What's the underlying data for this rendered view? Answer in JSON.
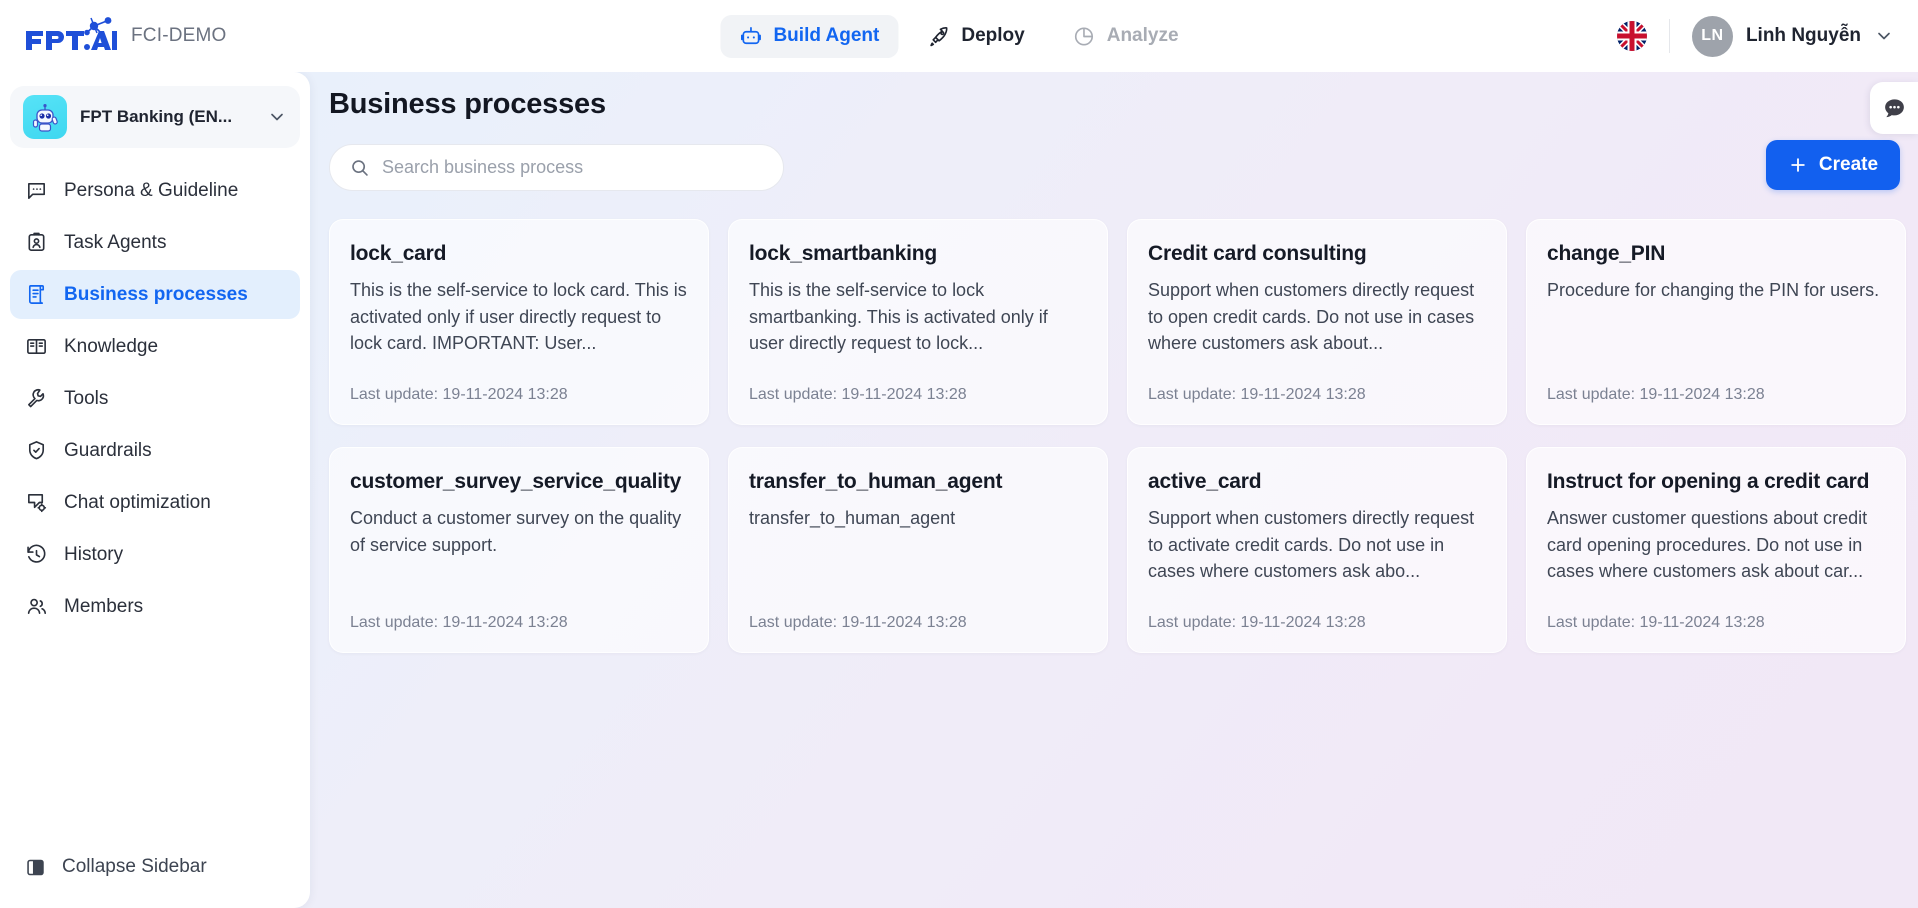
{
  "header": {
    "brand_name": "FPT.AI",
    "brand_sub": "FCI-DEMO",
    "tabs": [
      {
        "label": "Build Agent",
        "icon": "robot-icon",
        "state": "active"
      },
      {
        "label": "Deploy",
        "icon": "rocket-icon",
        "state": "default"
      },
      {
        "label": "Analyze",
        "icon": "pie-chart-icon",
        "state": "disabled"
      }
    ],
    "language_flag": "uk-flag-icon",
    "user": {
      "initials": "LN",
      "name": "Linh Nguyễn"
    }
  },
  "sidebar": {
    "agent": {
      "name": "FPT Banking (EN...",
      "avatar": "robot-avatar"
    },
    "items": [
      {
        "label": "Persona & Guideline",
        "icon": "chat-dots-icon",
        "active": false
      },
      {
        "label": "Task Agents",
        "icon": "id-badge-icon",
        "active": false
      },
      {
        "label": "Business processes",
        "icon": "scroll-document-icon",
        "active": true
      },
      {
        "label": "Knowledge",
        "icon": "open-book-icon",
        "active": false
      },
      {
        "label": "Tools",
        "icon": "wrench-icon",
        "active": false
      },
      {
        "label": "Guardrails",
        "icon": "shield-check-icon",
        "active": false
      },
      {
        "label": "Chat optimization",
        "icon": "chat-gear-icon",
        "active": false
      },
      {
        "label": "History",
        "icon": "clock-history-icon",
        "active": false
      },
      {
        "label": "Members",
        "icon": "users-icon",
        "active": false
      }
    ],
    "collapse_label": "Collapse Sidebar",
    "collapse_icon": "panel-collapse-icon"
  },
  "main": {
    "title": "Business processes",
    "search": {
      "placeholder": "Search business process",
      "value": "",
      "icon": "search-icon"
    },
    "create_button": {
      "label": "Create",
      "icon": "plus-icon"
    },
    "cards": [
      {
        "title": "lock_card",
        "description": "This is the self-service to lock card. This is activated only if user directly request to lock card. IMPORTANT: User...",
        "updated": "Last update: 19-11-2024 13:28"
      },
      {
        "title": "lock_smartbanking",
        "description": "This is the self-service to lock smartbanking. This is activated only if user directly request to lock...",
        "updated": "Last update: 19-11-2024 13:28"
      },
      {
        "title": "Credit card consulting",
        "description": "Support when customers directly request to open credit cards. Do not use in cases where customers ask about...",
        "updated": "Last update: 19-11-2024 13:28"
      },
      {
        "title": "change_PIN",
        "description": "Procedure for changing the PIN for users.",
        "updated": "Last update: 19-11-2024 13:28"
      },
      {
        "title": "customer_survey_service_quality",
        "description": "Conduct a customer survey on the quality of service support.",
        "updated": "Last update: 19-11-2024 13:28"
      },
      {
        "title": "transfer_to_human_agent",
        "description": "transfer_to_human_agent",
        "updated": "Last update: 19-11-2024 13:28"
      },
      {
        "title": "active_card",
        "description": "Support when customers directly request to activate credit cards. Do not use in cases where customers ask abo...",
        "updated": "Last update: 19-11-2024 13:28"
      },
      {
        "title": "Instruct for opening a credit card",
        "description": "Answer customer questions about credit card opening procedures. Do not use in cases where customers ask about car...",
        "updated": "Last update: 19-11-2024 13:28"
      }
    ]
  },
  "chat_widget": {
    "icon": "chat-bubble-dots-icon"
  },
  "colors": {
    "accent_blue": "#1266f1",
    "create_button": "#1260ef",
    "active_nav_bg": "#e3effd",
    "sidebar_bg": "#ffffff",
    "text_primary": "#151a26",
    "text_muted": "#7b8192"
  }
}
